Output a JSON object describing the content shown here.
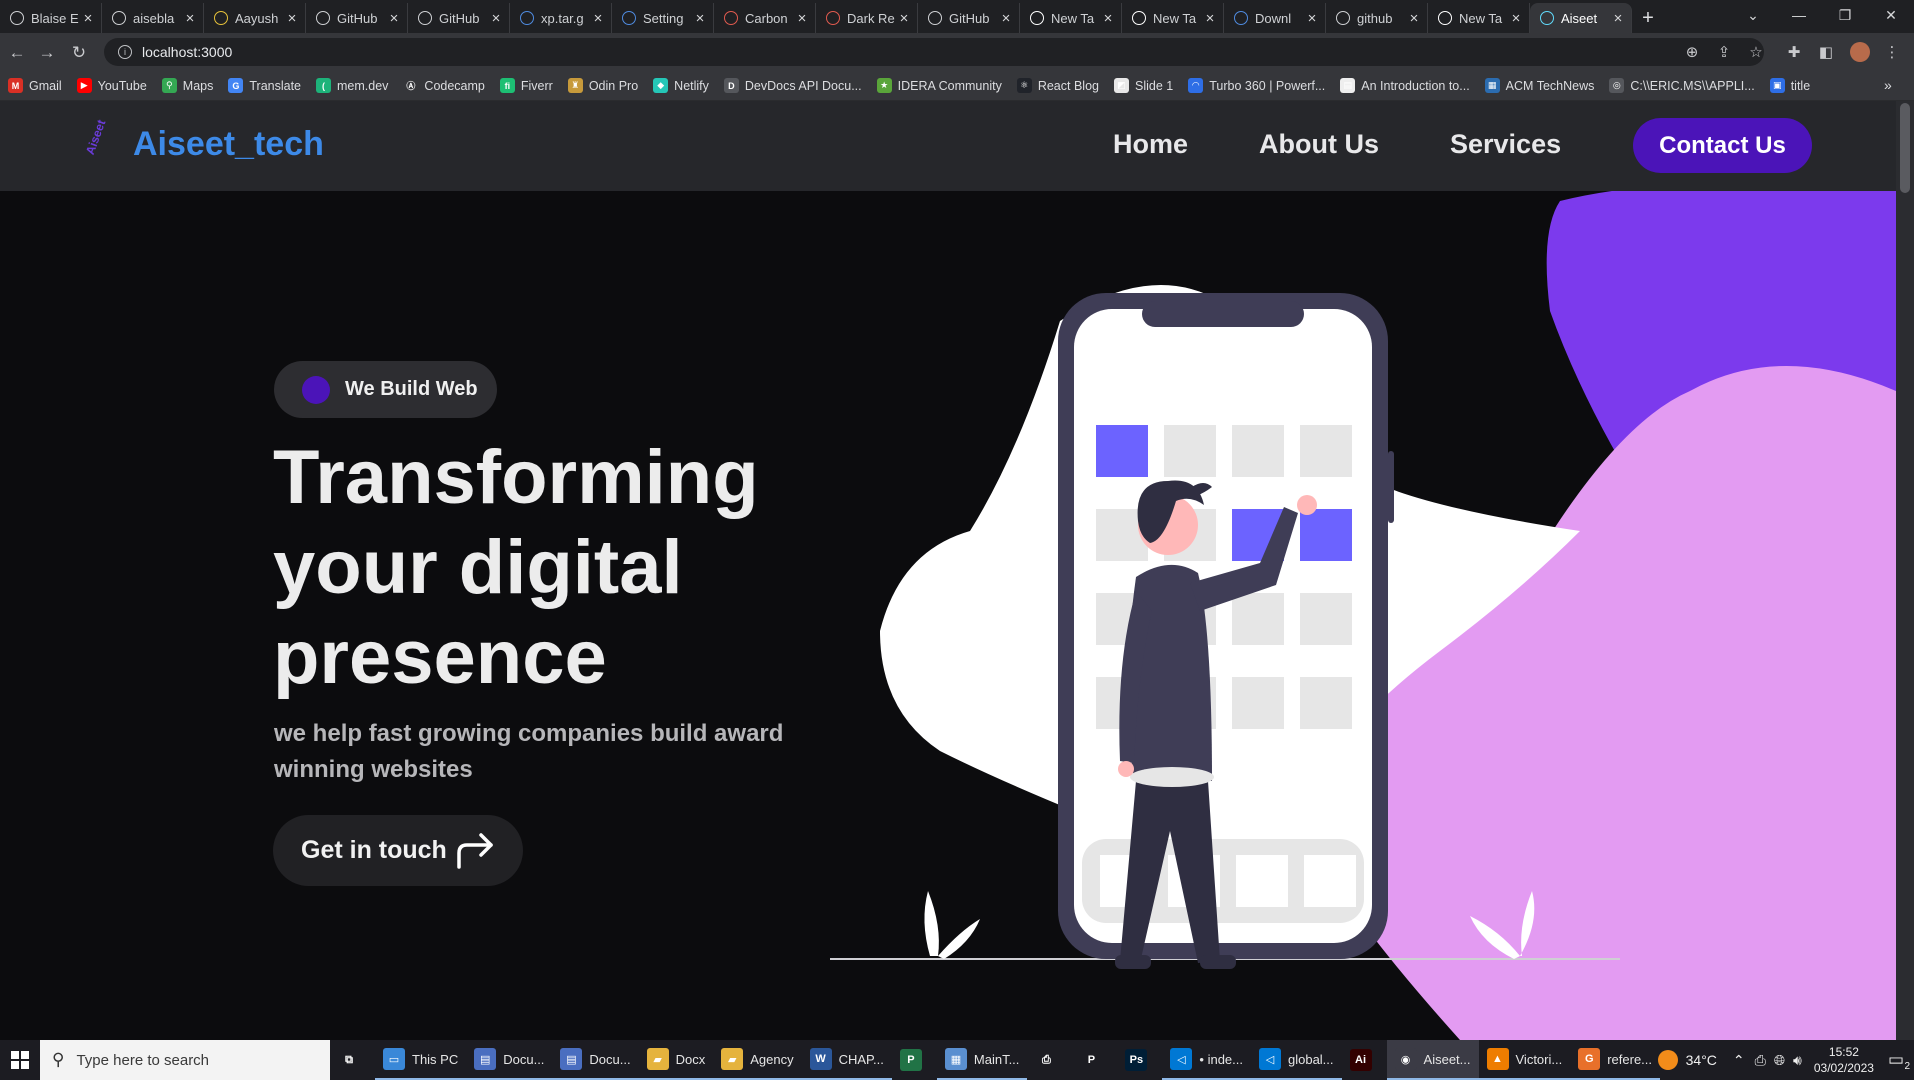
{
  "browser": {
    "tabs": [
      {
        "label": "Blaise E",
        "icon": "github-icon",
        "color": "#cfd1d4"
      },
      {
        "label": "aisebla",
        "icon": "github-icon",
        "color": "#cfd1d4"
      },
      {
        "label": "Aayush",
        "icon": "ak-icon",
        "color": "#e6c13a"
      },
      {
        "label": "GitHub",
        "icon": "github-icon",
        "color": "#cfd1d4"
      },
      {
        "label": "GitHub",
        "icon": "github-icon",
        "color": "#cfd1d4"
      },
      {
        "label": "xp.tar.g",
        "icon": "image-icon",
        "color": "#4f8be0"
      },
      {
        "label": "Setting",
        "icon": "gear-icon",
        "color": "#4f8be0"
      },
      {
        "label": "Carbon",
        "icon": "carbon-icon",
        "color": "#e05a4f"
      },
      {
        "label": "Dark Re",
        "icon": "dark-reader-icon",
        "color": "#e05a4f"
      },
      {
        "label": "GitHub",
        "icon": "github-icon",
        "color": "#cfd1d4"
      },
      {
        "label": "New Ta",
        "icon": "chrome-icon",
        "color": "#ffffff"
      },
      {
        "label": "New Ta",
        "icon": "chrome-icon",
        "color": "#ffffff"
      },
      {
        "label": "Downl",
        "icon": "download-icon",
        "color": "#4f8be0"
      },
      {
        "label": "github",
        "icon": "globe-icon",
        "color": "#cfd1d4"
      },
      {
        "label": "New Ta",
        "icon": "chrome-icon",
        "color": "#ffffff"
      },
      {
        "label": "Aiseet",
        "icon": "react-icon",
        "color": "#61dafb"
      }
    ],
    "url": "localhost:3000",
    "bookmarks": [
      {
        "label": "Gmail",
        "color": "#d93025",
        "glyph": "M"
      },
      {
        "label": "YouTube",
        "color": "#ff0000",
        "glyph": "▶"
      },
      {
        "label": "Maps",
        "color": "#34a853",
        "glyph": "⚲"
      },
      {
        "label": "Translate",
        "color": "#4285f4",
        "glyph": "G"
      },
      {
        "label": "mem.dev",
        "color": "#1db37a",
        "glyph": "("
      },
      {
        "label": "Codecamp",
        "color": "#35363a",
        "glyph": "Ⓐ"
      },
      {
        "label": "Fiverr",
        "color": "#1dbf73",
        "glyph": "fi"
      },
      {
        "label": "Odin Pro",
        "color": "#c79a3b",
        "glyph": "♜"
      },
      {
        "label": "Netlify",
        "color": "#25c7b7",
        "glyph": "◆"
      },
      {
        "label": "DevDocs API Docu...",
        "color": "#55575c",
        "glyph": "D"
      },
      {
        "label": "IDERA Community",
        "color": "#5aa53a",
        "glyph": "★"
      },
      {
        "label": "React Blog",
        "color": "#20232a",
        "glyph": "⚛"
      },
      {
        "label": "Slide 1",
        "color": "#e8e8e8",
        "glyph": "◩"
      },
      {
        "label": "Turbo 360 | Powerf...",
        "color": "#2e6ee6",
        "glyph": "◠"
      },
      {
        "label": "An Introduction to...",
        "color": "#eeeeee",
        "glyph": "▤"
      },
      {
        "label": "ACM TechNews",
        "color": "#2b6cb0",
        "glyph": "▦"
      },
      {
        "label": "C:\\\\ERIC.MS\\\\APPLI...",
        "color": "#55575c",
        "glyph": "◎"
      },
      {
        "label": "title",
        "color": "#2e6ee6",
        "glyph": "▣"
      }
    ]
  },
  "site": {
    "brand": "Aiseet_tech",
    "logo_text": "Aiseet",
    "nav": [
      "Home",
      "About Us",
      "Services"
    ],
    "contact_label": "Contact Us",
    "badge": "We Build Web",
    "headline": [
      "Transforming",
      "your digital",
      "presence"
    ],
    "subline": "we help fast growing companies build award winning websites",
    "cta_label": "Get in touch",
    "colors": {
      "accent": "#4b14b8",
      "brand": "#3d8ae8",
      "tile_active": "#6c63ff",
      "blob_purple": "#7c3aed",
      "blob_pink": "#e39bf2"
    }
  },
  "taskbar": {
    "search_placeholder": "Type here to search",
    "apps": [
      {
        "label": "",
        "icon": "task-view-icon",
        "color": "#1c1c22"
      },
      {
        "label": "This PC",
        "icon": "pc-icon",
        "color": "#3a88d8"
      },
      {
        "label": "Docu...",
        "icon": "document-icon",
        "color": "#4a6ec0"
      },
      {
        "label": "Docu...",
        "icon": "document-icon",
        "color": "#4a6ec0"
      },
      {
        "label": "Docx",
        "icon": "folder-icon",
        "color": "#e5b33d"
      },
      {
        "label": "Agency",
        "icon": "folder-icon",
        "color": "#e5b33d"
      },
      {
        "label": "CHAP...",
        "icon": "word-icon",
        "color": "#2b579a"
      },
      {
        "label": "",
        "icon": "project-icon",
        "color": "#217346"
      },
      {
        "label": "MainT...",
        "icon": "paint-icon",
        "color": "#5a8fd0"
      },
      {
        "label": "",
        "icon": "printer-icon",
        "color": "#1c1c22"
      },
      {
        "label": "",
        "icon": "p-icon",
        "color": "#1c1c22"
      },
      {
        "label": "",
        "icon": "photoshop-icon",
        "color": "#001e36"
      },
      {
        "label": "• inde...",
        "icon": "vscode-icon",
        "color": "#0078d4"
      },
      {
        "label": "global...",
        "icon": "vscode-icon",
        "color": "#0078d4"
      },
      {
        "label": "",
        "icon": "illustrator-icon",
        "color": "#330000"
      },
      {
        "label": "Aiseet...",
        "icon": "chrome-icon",
        "color": "#3b3b45"
      },
      {
        "label": "Victori...",
        "icon": "vlc-icon",
        "color": "#ee7d00"
      },
      {
        "label": "refere...",
        "icon": "orange-g-icon",
        "color": "#e8702a"
      }
    ],
    "temperature": "34°C",
    "time": "15:52",
    "date": "03/02/2023",
    "notification_count": "2"
  }
}
